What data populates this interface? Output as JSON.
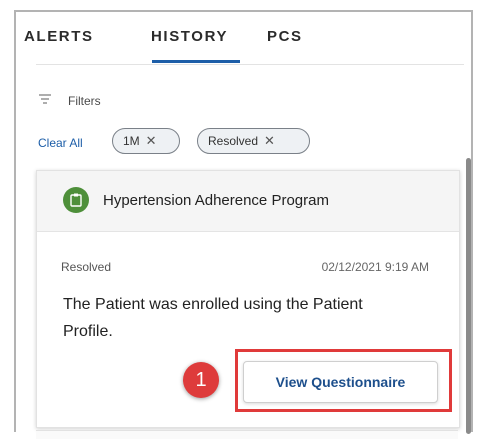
{
  "tabs": {
    "alerts": "ALERTS",
    "history": "HISTORY",
    "pcs": "PCS",
    "active": "HISTORY"
  },
  "filters": {
    "label": "Filters",
    "clear_all": "Clear All",
    "chips": [
      {
        "label": "1M",
        "remove": "✕"
      },
      {
        "label": "Resolved",
        "remove": "✕"
      }
    ]
  },
  "card": {
    "program_title": "Hypertension Adherence Program",
    "status": "Resolved",
    "timestamp": "02/12/2021 9:19 AM",
    "message": "The Patient was enrolled using the Patient Profile.",
    "action_label": "View Questionnaire"
  },
  "annotation": {
    "step_number": "1",
    "highlight_color": "#e03a3a"
  },
  "colors": {
    "accent": "#1d5ea8",
    "program_icon_bg": "#4e8f3a",
    "badge": "#de3b3b"
  }
}
